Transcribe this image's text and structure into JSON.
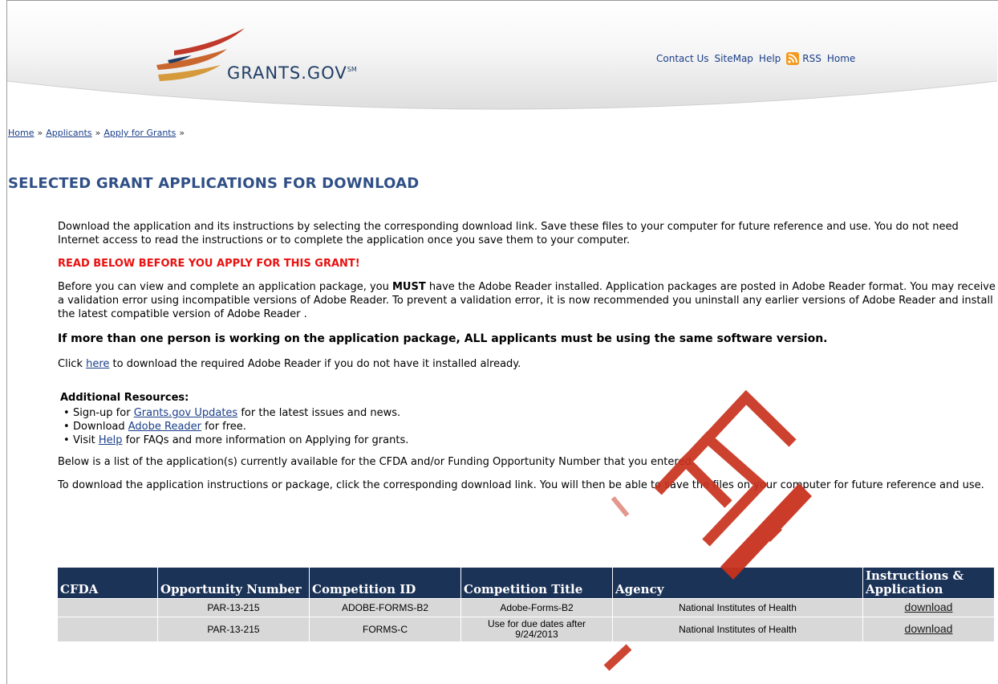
{
  "header": {
    "logo_text": "GRANTS.GOV",
    "logo_mark": "SM",
    "links": [
      "Contact Us",
      "SiteMap",
      "Help",
      "RSS",
      "Home"
    ]
  },
  "breadcrumb": [
    "Home",
    "Applicants",
    "Apply for Grants"
  ],
  "breadcrumb_sep": "»",
  "title": "SELECTED GRANT APPLICATIONS FOR DOWNLOAD",
  "content": {
    "p1": "Download the application and its instructions by selecting the corresponding download link. Save these files to your computer for future reference and use. You do not need Internet access to read the instructions or to complete the application once you save them to your computer.",
    "warning": "READ BELOW BEFORE YOU APPLY FOR THIS GRANT!",
    "p2_pre": "Before you can view and complete an application package, you ",
    "p2_bold": "MUST",
    "p2_post": " have the Adobe Reader installed. Application packages are posted in Adobe Reader format. You may receive a validation error using incompatible versions of Adobe Reader. To prevent a validation error, it is now recommended you uninstall any earlier versions of Adobe Reader and install the latest compatible version of Adobe Reader .",
    "bold_line": "If more than one person is working on the application package, ALL applicants must be using the same software version.",
    "click_pre": "Click ",
    "click_link": "here",
    "click_post": " to download the required Adobe Reader if you do not have it installed already.",
    "resources_title": "Additional Resources:",
    "resources": [
      {
        "pre": "Sign-up for ",
        "link": "Grants.gov Updates",
        "post": " for the latest issues and news."
      },
      {
        "pre": "Download ",
        "link": "Adobe Reader",
        "post": " for free."
      },
      {
        "pre": "Visit ",
        "link": "Help",
        "post": " for FAQs and more information on Applying for grants."
      }
    ],
    "below1": "Below is a list of the application(s) currently available for the CFDA and/or Funding Opportunity Number that you entered.",
    "below2": "To download the application instructions or package, click the corresponding download link. You will then be able to save the files on your computer for future reference and use."
  },
  "table": {
    "headers": [
      "CFDA",
      "Opportunity Number",
      "Competition ID",
      "Competition Title",
      "Agency",
      "Instructions & Application"
    ],
    "rows": [
      {
        "cfda": "",
        "opportunity": "PAR-13-215",
        "competition_id": "ADOBE-FORMS-B2",
        "title": "Adobe-Forms-B2",
        "agency": "National Institutes of Health",
        "action": "download"
      },
      {
        "cfda": "",
        "opportunity": "PAR-13-215",
        "competition_id": "FORMS-C",
        "title": "Use for due dates after 9/24/2013",
        "agency": "National Institutes of Health",
        "action": "download"
      }
    ]
  },
  "colors": {
    "title": "#2f4f86",
    "warning": "#e8110f",
    "table_header": "#1c3358",
    "table_row": "#d8d8d8",
    "link": "#1a3e8a"
  }
}
